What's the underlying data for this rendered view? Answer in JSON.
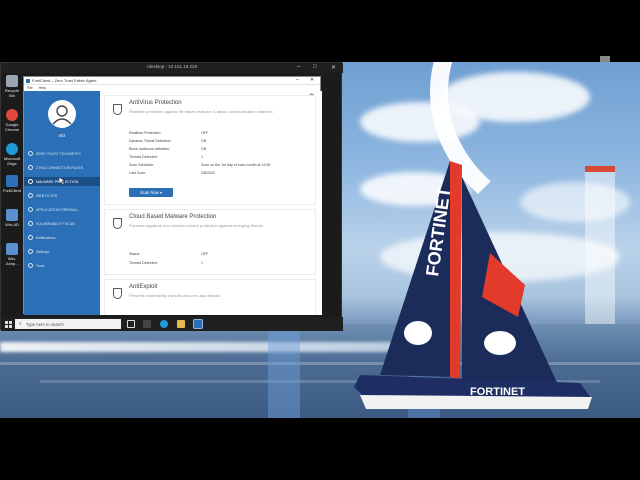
{
  "remote_window": {
    "title": "rdesktop - 10.101.19.229",
    "ctrl_minimize": "–",
    "ctrl_maximize": "□",
    "ctrl_close": "✕"
  },
  "desktop_icons": [
    {
      "label": "Recycle Bin",
      "icon": "recycle-bin-icon",
      "color": "#9aa5b1"
    },
    {
      "label": "Google Chrome",
      "icon": "chrome-icon",
      "color": "#e0483b"
    },
    {
      "label": "Microsoft Edge",
      "icon": "edge-icon",
      "color": "#1e9bd7"
    },
    {
      "label": "FortiClient",
      "icon": "forticlient-icon",
      "color": "#2b6fb7"
    },
    {
      "label": "Win-AD",
      "icon": "computer-icon",
      "color": "#5b8fd0"
    },
    {
      "label": "Win-Jump...",
      "icon": "computer-icon",
      "color": "#5b8fd0"
    }
  ],
  "forticlient": {
    "title": "FortiClient – Zero Trust Fabric Agent",
    "menu": [
      "File",
      "Help"
    ],
    "username": "mlz",
    "nav": [
      {
        "label": "ZERO TRUST TELEMETRY",
        "icon": "telemetry-icon"
      },
      {
        "label": "ZTNA CONNECTION RULES",
        "icon": "ztna-icon"
      },
      {
        "label": "MALWARE PROTECTION",
        "icon": "shield-icon",
        "active": true
      },
      {
        "label": "WEB FILTER",
        "icon": "web-filter-icon"
      },
      {
        "label": "APPLICATION FIREWALL",
        "icon": "firewall-icon"
      },
      {
        "label": "VULNERABILITY SCAN",
        "icon": "scan-icon"
      },
      {
        "label": "Notifications",
        "icon": "bell-icon"
      },
      {
        "label": "Settings",
        "icon": "gear-icon"
      },
      {
        "label": "Tools",
        "icon": "tools-icon"
      }
    ],
    "antivirus": {
      "title": "AntiVirus Protection",
      "desc": "Realtime protection against file based malware & attack communication channels",
      "rows": [
        {
          "k": "Realtime Protection:",
          "v": "OFF"
        },
        {
          "k": "Dynamic Threat Detection:",
          "v": "ON"
        },
        {
          "k": "Block malicious websites:",
          "v": "ON"
        },
        {
          "k": "Threats Detected:",
          "v": "1"
        },
        {
          "k": "Scan Schedule:",
          "v": "Scan on the 1st day of each month at 19:30"
        },
        {
          "k": "Last Scan:",
          "v": "2/8/2022"
        }
      ],
      "scan_button": "Scan Now ▾"
    },
    "cloud": {
      "title": "Cloud Based Malware Protection",
      "desc": "Provides signature-less behavior based protection against emerging threats",
      "rows": [
        {
          "k": "Status:",
          "v": "OFF"
        },
        {
          "k": "Threats Detected:",
          "v": "1"
        }
      ]
    },
    "antiexploit": {
      "title": "AntiExploit",
      "desc": "Prevents vulnerability exploits and zero-day attacks"
    }
  },
  "taskbar": {
    "search_placeholder": "Type here to search"
  },
  "banner_text": "FORTINET"
}
